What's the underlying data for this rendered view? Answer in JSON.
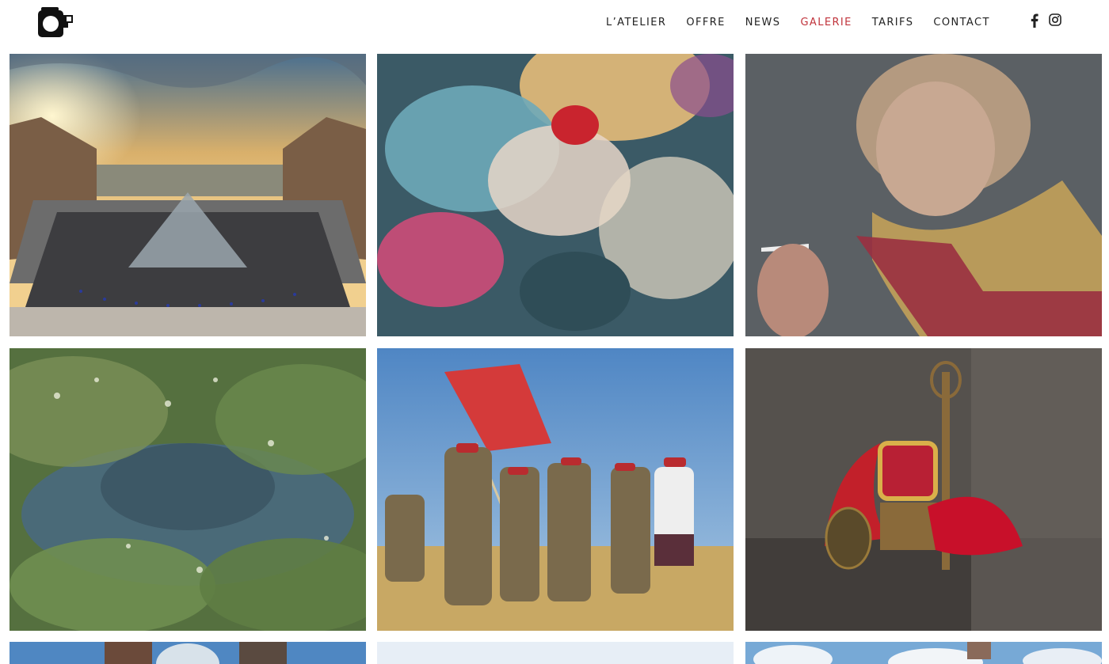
{
  "site": {
    "logo_icon": "camera-logo-icon"
  },
  "nav": {
    "items": [
      {
        "label": "L’ATELIER"
      },
      {
        "label": "OFFRE"
      },
      {
        "label": "NEWS"
      },
      {
        "label": "GALERIE",
        "active": true
      },
      {
        "label": "TARIFS"
      },
      {
        "label": "CONTACT"
      }
    ],
    "active_color": "#c0333b",
    "text_color": "#222222"
  },
  "social": {
    "icons": [
      "facebook-icon",
      "instagram-icon"
    ]
  },
  "gallery": {
    "columns": 3,
    "images": [
      {
        "subject": "louvre-pyramid-sunset"
      },
      {
        "subject": "underwater-abstract"
      },
      {
        "subject": "elderly-woman-smoking-portrait"
      },
      {
        "subject": "overgrown-vintage-car"
      },
      {
        "subject": "marchers-red-flag"
      },
      {
        "subject": "still-life-red-fabric"
      },
      {
        "subject": "clock-partial"
      },
      {
        "subject": "pale-sky-partial"
      },
      {
        "subject": "blue-sky-clouds-partial"
      }
    ]
  }
}
